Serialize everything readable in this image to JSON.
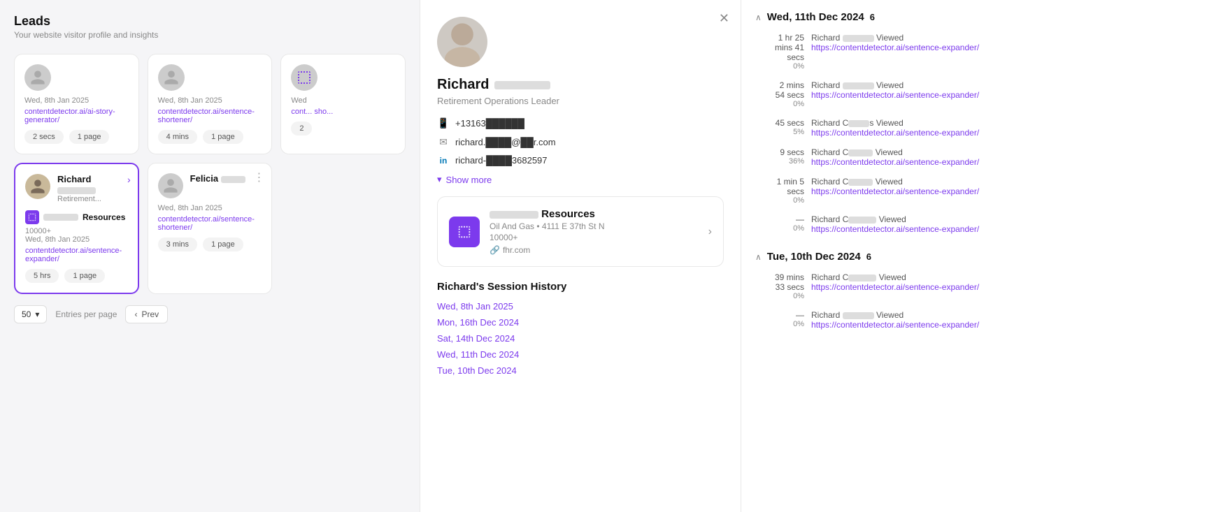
{
  "header": {
    "title": "Leads",
    "subtitle": "Your website visitor profile and insights"
  },
  "cards": [
    {
      "id": "card1",
      "type": "unknown",
      "date": "Wed, 8th Jan 2025",
      "link": "contentdetector.ai/ai-story-generator/",
      "time": "2 secs",
      "pages": "1 page",
      "selected": false
    },
    {
      "id": "card2",
      "type": "unknown",
      "date": "Wed, 8th Jan 2025",
      "link": "contentdetector.ai/sentence-shortener/",
      "time": "4 mins",
      "pages": "1 page",
      "selected": false
    },
    {
      "id": "card3",
      "type": "partial",
      "date": "Wed",
      "link": "cont... sho...",
      "time": "2",
      "pages": "",
      "selected": false
    },
    {
      "id": "card4",
      "name": "Richard",
      "role": "Retirement...",
      "company": "Resources",
      "count": "10000+",
      "date": "Wed, 8th Jan 2025",
      "link": "contentdetector.ai/sentence-expander/",
      "time": "5 hrs",
      "pages": "1 page",
      "selected": true
    },
    {
      "id": "card5",
      "name": "Felicia",
      "role": "",
      "company": "",
      "count": "",
      "date": "Wed, 8th Jan 2025",
      "link": "contentdetector.ai/sentence-shortener/",
      "time": "3 mins",
      "pages": "1 page",
      "selected": false
    }
  ],
  "pagination": {
    "per_page": "50",
    "per_page_label": "Entries per page",
    "prev_label": "Prev",
    "chevron_down": "▾",
    "chevron_left": "‹"
  },
  "profile": {
    "name": "Richard",
    "role": "Retirement Operations Leader",
    "phone": "+13163██████",
    "email": "richard.████@██r.com",
    "linkedin": "richard-████3682597",
    "show_more": "Show more",
    "company": {
      "name": "██████ Resources",
      "detail": "Oil And Gas • 4111 E 37th St N",
      "count": "10000+",
      "website": "fhr.com"
    },
    "session_history_title": "Richard's Session History",
    "sessions": [
      {
        "label": "Wed, 8th Jan 2025",
        "active": true
      },
      {
        "label": "Mon, 16th Dec 2024",
        "active": false
      },
      {
        "label": "Sat, 14th Dec 2024",
        "active": false
      },
      {
        "label": "Wed, 11th Dec 2024",
        "active": false
      },
      {
        "label": "Tue, 10th Dec 2024",
        "active": false
      }
    ]
  },
  "activity": {
    "days": [
      {
        "date": "Wed, 11th Dec 2024",
        "count": 6,
        "items": [
          {
            "time": "1 hr 25 mins 41 secs",
            "pct": "0%",
            "name": "Richard ██████ Viewed",
            "link": "https://contentdetector.ai/sentence-expander/"
          },
          {
            "time": "2 mins 54 secs",
            "pct": "0%",
            "name": "Richard ██████ Viewed",
            "link": "https://contentdetector.ai/sentence-expander/"
          },
          {
            "time": "45 secs",
            "pct": "5%",
            "name": "Richard C████s Viewed",
            "link": "https://contentdetector.ai/sentence-expander/"
          },
          {
            "time": "9 secs",
            "pct": "36%",
            "name": "Richard C█████ Viewed",
            "link": "https://contentdetector.ai/sentence-expander/"
          },
          {
            "time": "1 min 5 secs",
            "pct": "0%",
            "name": "Richard C█████ Viewed",
            "link": "https://contentdetector.ai/sentence-expander/"
          },
          {
            "time": "—",
            "pct": "0%",
            "name": "Richard C██████ Viewed",
            "link": "https://contentdetector.ai/sentence-expander/"
          }
        ]
      },
      {
        "date": "Tue, 10th Dec 2024",
        "count": 6,
        "items": [
          {
            "time": "39 mins 33 secs",
            "pct": "0%",
            "name": "Richard C██████ Viewed",
            "link": "https://contentdetector.ai/sentence-expander/"
          },
          {
            "time": "—",
            "pct": "0%",
            "name": "Richard ██████ Viewed",
            "link": "https://contentdetector.ai/sentence-expander/"
          }
        ]
      }
    ]
  }
}
